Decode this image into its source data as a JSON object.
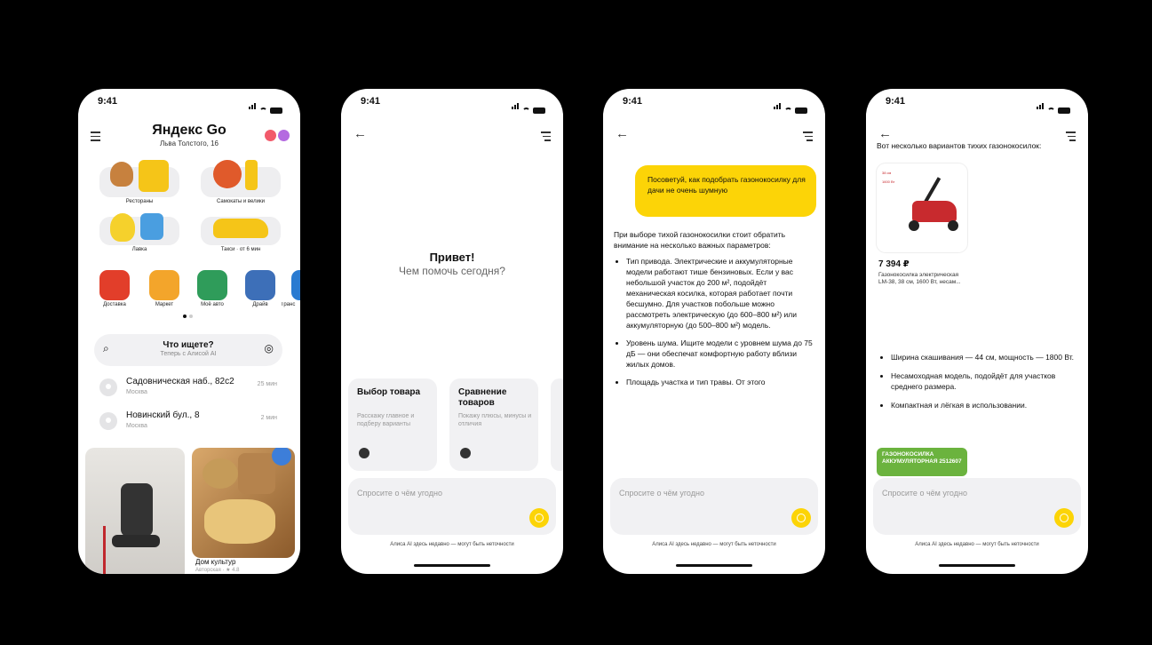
{
  "status": {
    "time": "9:41"
  },
  "home": {
    "brand": "Яндекс Go",
    "address": "Льва Толстого, 16",
    "tiles": [
      {
        "label": "Рестораны"
      },
      {
        "label": "Самокаты и велики"
      },
      {
        "label": "Лавка"
      },
      {
        "label": "Такси · от 6 мин"
      }
    ],
    "services": [
      "Доставка",
      "Маркет",
      "Моё авто",
      "Драйв",
      "Транс"
    ],
    "search": {
      "title": "Что ищете?",
      "subtitle": "Теперь с Алисой AI"
    },
    "routes": [
      {
        "name": "Садовническая наб., 82с2",
        "city": "Москва",
        "eta": "25 мин"
      },
      {
        "name": "Новинский бул., 8",
        "city": "Москва",
        "eta": "2 мин"
      }
    ],
    "food_card": {
      "name": "Дом культур",
      "meta": "Авторская · ★ 4.8"
    }
  },
  "chat_empty": {
    "greeting": "Привет!",
    "subtitle": "Чем помочь сегодня?",
    "suggestions": [
      {
        "title": "Выбор товара",
        "desc": "Расскажу главное и подберу варианты"
      },
      {
        "title": "Сравнение товаров",
        "desc": "Покажу плюсы, минусы и отличия"
      }
    ]
  },
  "input": {
    "placeholder": "Спросите о чём угодно",
    "disclaimer": "Алиса AI здесь недавно — могут быть неточности"
  },
  "chat_answer": {
    "question": "Посоветуй, как подобрать газонокосилку для дачи не очень шумную",
    "intro": "При выборе тихой газонокосилки стоит обратить внимание на несколько важных параметров:",
    "bullets": [
      "Тип привода. Электрические и аккумуляторные модели работают тише бензиновых. Если у вас небольшой участок до 200 м², подойдёт механическая косилка, которая работает почти бесшумно. Для участков побольше можно рассмотреть электрическую (до 600–800 м²) или аккумуляторную (до 500–800 м²) модель.",
      "Уровень шума. Ищите модели с уровнем шума до 75 дБ — они обеспечат комфортную работу вблизи жилых домов.",
      "Площадь участка и тип травы. От этого"
    ]
  },
  "chat_products": {
    "intro": "Вот несколько вариантов тихих газонокосилок:",
    "product": {
      "price": "7 394 ₽",
      "name": "Газонокосилка электрическая LM-38, 38 см, 1600 Вт, несам...",
      "spec1": "38 см",
      "spec2": "1600 Вт"
    },
    "bullets": [
      "Ширина скашивания — 44 см, мощность — 1800 Вт.",
      "Несамоходная модель, подойдёт для участков среднего размера.",
      "Компактная и лёгкая в использовании."
    ],
    "promo": "ГАЗОНОКОСИЛКА АККУМУЛЯТОРНАЯ 2512607"
  },
  "colors": {
    "accent": "#fcd407",
    "background": "#000000"
  }
}
